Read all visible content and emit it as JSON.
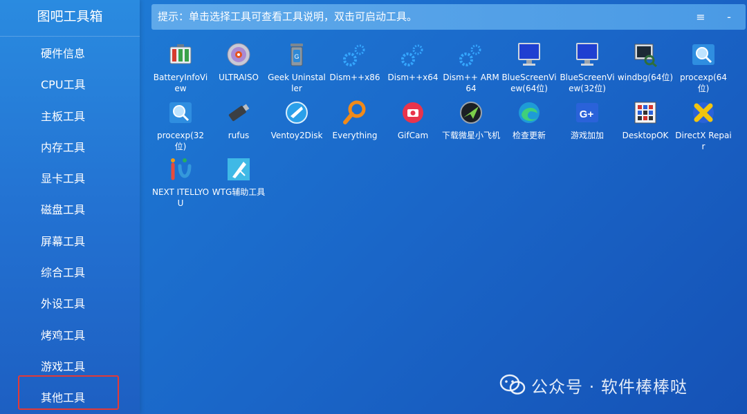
{
  "sidebar": {
    "title": "图吧工具箱",
    "items": [
      {
        "label": "硬件信息"
      },
      {
        "label": "CPU工具"
      },
      {
        "label": "主板工具"
      },
      {
        "label": "内存工具"
      },
      {
        "label": "显卡工具"
      },
      {
        "label": "磁盘工具"
      },
      {
        "label": "屏幕工具"
      },
      {
        "label": "综合工具"
      },
      {
        "label": "外设工具"
      },
      {
        "label": "烤鸡工具"
      },
      {
        "label": "游戏工具"
      },
      {
        "label": "其他工具"
      }
    ],
    "selected": "其他工具"
  },
  "topbar": {
    "hint": "提示：单击选择工具可查看工具说明，双击可启动工具。",
    "menu_symbol": "≡",
    "minimize_symbol": "-"
  },
  "tools": [
    {
      "label": "BatteryInfoView",
      "icon": "battery-icon"
    },
    {
      "label": "ULTRAISO",
      "icon": "disc-icon"
    },
    {
      "label": "Geek Uninstaller",
      "icon": "trash-can-icon"
    },
    {
      "label": "Dism++x86",
      "icon": "gears-icon"
    },
    {
      "label": "Dism++x64",
      "icon": "gears-icon"
    },
    {
      "label": "Dism++ ARM64",
      "icon": "gears-icon"
    },
    {
      "label": "BlueScreenView(64位)",
      "icon": "monitor-icon"
    },
    {
      "label": "BlueScreenView(32位)",
      "icon": "monitor-icon"
    },
    {
      "label": "windbg(64位)",
      "icon": "debugger-icon"
    },
    {
      "label": "procexp(64位)",
      "icon": "process-explorer-icon"
    },
    {
      "label": "procexp(32位)",
      "icon": "process-explorer-icon"
    },
    {
      "label": "rufus",
      "icon": "usb-drive-icon"
    },
    {
      "label": "Ventoy2Disk",
      "icon": "ventoy-icon"
    },
    {
      "label": "Everything",
      "icon": "magnifier-icon"
    },
    {
      "label": "GifCam",
      "icon": "camera-icon"
    },
    {
      "label": "下载微星小飞机",
      "icon": "afterburner-icon"
    },
    {
      "label": "检查更新",
      "icon": "edge-icon"
    },
    {
      "label": "游戏加加",
      "icon": "gplus-icon"
    },
    {
      "label": "DesktopOK",
      "icon": "grid-icon"
    },
    {
      "label": "DirectX Repair",
      "icon": "directx-icon"
    },
    {
      "label": "NEXT ITELLYOU",
      "icon": "itellyou-icon"
    },
    {
      "label": "WTG辅助工具",
      "icon": "wtg-icon"
    }
  ],
  "watermark": {
    "text": "公众号 · 软件棒棒哒",
    "icon": "wechat-icon"
  },
  "colors": {
    "background": "#1a66c8",
    "sidebar": "#2372d2",
    "highlight": "#e53935"
  }
}
